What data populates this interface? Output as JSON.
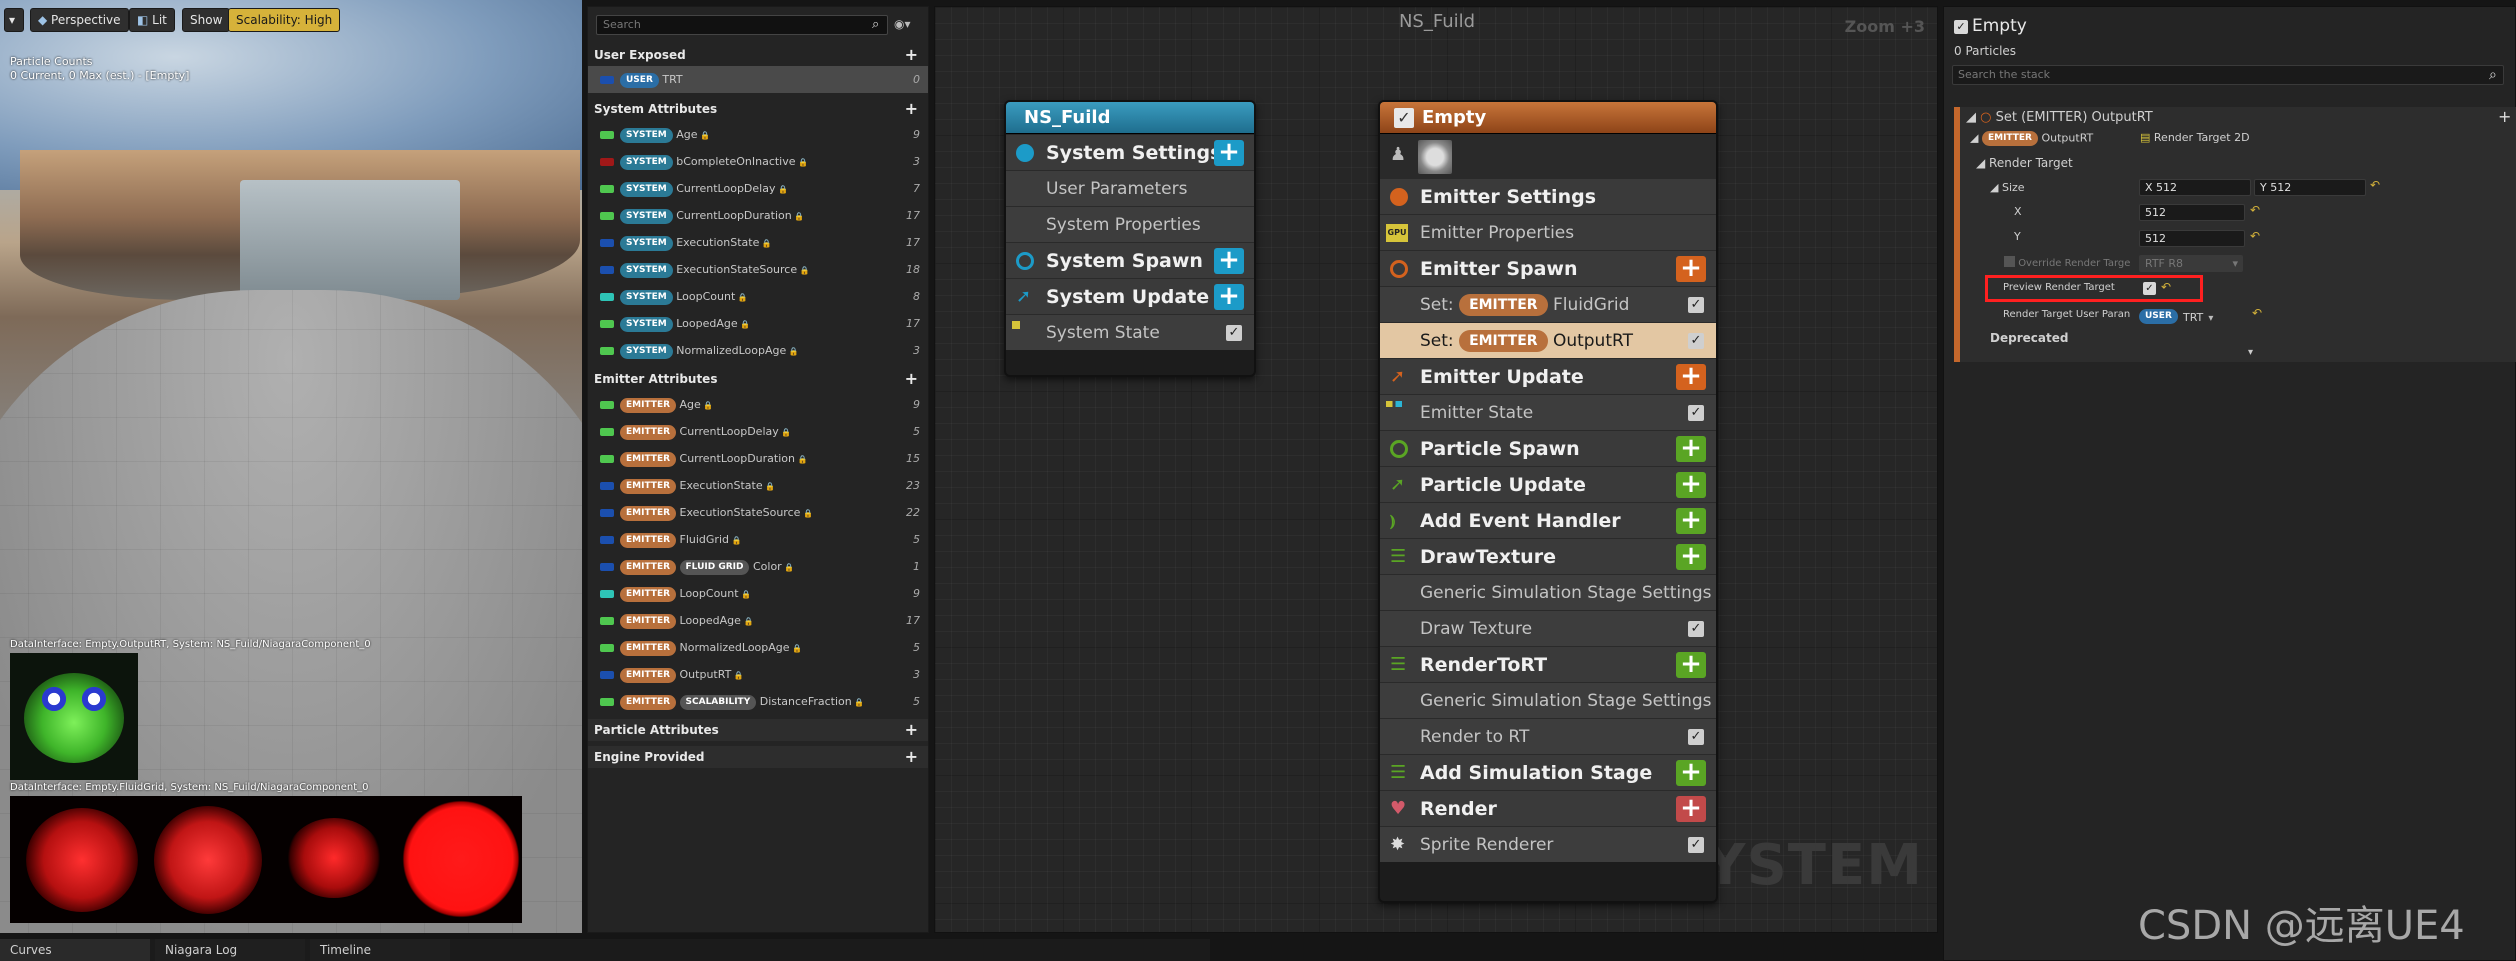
{
  "viewport": {
    "toolbar": {
      "menu": "▾",
      "perspective": "Perspective",
      "lit": "Lit",
      "show": "Show",
      "scalability": "Scalability: High"
    },
    "stats_line1": "Particle Counts",
    "stats_line2": "0 Current, 0 Max (est.) - [Empty]",
    "di_label_1": "DataInterface: Empty.OutputRT, System: NS_Fuild/NiagaraComponent_0",
    "di_label_2": "DataInterface: Empty.FluidGrid, System: NS_Fuild/NiagaraComponent_0"
  },
  "bottom_tabs": [
    "Curves",
    "Niagara Log",
    "Timeline"
  ],
  "params": {
    "search_placeholder": "Search",
    "user_exposed": {
      "title": "User Exposed",
      "items": [
        {
          "badge": "USER",
          "name": "TRT",
          "num": "0"
        }
      ]
    },
    "system_attributes": {
      "title": "System Attributes",
      "items": [
        {
          "badge": "SYSTEM",
          "name": "Age",
          "num": "9"
        },
        {
          "badge": "SYSTEM",
          "name": "bCompleteOnInactive",
          "num": "3"
        },
        {
          "badge": "SYSTEM",
          "name": "CurrentLoopDelay",
          "num": "7"
        },
        {
          "badge": "SYSTEM",
          "name": "CurrentLoopDuration",
          "num": "17"
        },
        {
          "badge": "SYSTEM",
          "name": "ExecutionState",
          "num": "17"
        },
        {
          "badge": "SYSTEM",
          "name": "ExecutionStateSource",
          "num": "18"
        },
        {
          "badge": "SYSTEM",
          "name": "LoopCount",
          "num": "8"
        },
        {
          "badge": "SYSTEM",
          "name": "LoopedAge",
          "num": "17"
        },
        {
          "badge": "SYSTEM",
          "name": "NormalizedLoopAge",
          "num": "3"
        }
      ]
    },
    "emitter_attributes": {
      "title": "Emitter Attributes",
      "items": [
        {
          "badge": "EMITTER",
          "name": "Age",
          "num": "9"
        },
        {
          "badge": "EMITTER",
          "name": "CurrentLoopDelay",
          "num": "5"
        },
        {
          "badge": "EMITTER",
          "name": "CurrentLoopDuration",
          "num": "15"
        },
        {
          "badge": "EMITTER",
          "name": "ExecutionState",
          "num": "23"
        },
        {
          "badge": "EMITTER",
          "name": "ExecutionStateSource",
          "num": "22"
        },
        {
          "badge": "EMITTER",
          "name": "FluidGrid",
          "num": "5"
        },
        {
          "badge": "EMITTER",
          "badge2": "FLUID GRID",
          "name": "Color",
          "num": "1"
        },
        {
          "badge": "EMITTER",
          "name": "LoopCount",
          "num": "9"
        },
        {
          "badge": "EMITTER",
          "name": "LoopedAge",
          "num": "17"
        },
        {
          "badge": "EMITTER",
          "name": "NormalizedLoopAge",
          "num": "5"
        },
        {
          "badge": "EMITTER",
          "name": "OutputRT",
          "num": "3"
        },
        {
          "badge": "EMITTER",
          "badge2": "SCALABILITY",
          "name": "DistanceFraction",
          "num": "5"
        }
      ]
    },
    "particle_attributes": "Particle Attributes",
    "engine_provided": "Engine Provided"
  },
  "graph": {
    "title": "NS_Fuild",
    "zoom": "Zoom +3",
    "watermark": "SYSTEM",
    "system_node": {
      "title": "NS_Fuild",
      "rows": {
        "settings": "System Settings",
        "user_params": "User Parameters",
        "properties": "System Properties",
        "spawn": "System Spawn",
        "update": "System Update",
        "state": "System State"
      }
    },
    "emitter_node": {
      "title": "Empty",
      "rows": {
        "settings": "Emitter Settings",
        "properties": "Emitter Properties",
        "gpu": "GPU",
        "spawn": "Emitter Spawn",
        "set_prefix": "Set:",
        "set_badge": "EMITTER",
        "set1": "FluidGrid",
        "set2": "OutputRT",
        "update": "Emitter Update",
        "state": "Emitter State",
        "pspawn": "Particle Spawn",
        "pupdate": "Particle Update",
        "event": "Add Event Handler",
        "draw": "DrawTexture",
        "gen1": "Generic Simulation Stage Settings",
        "drawtex": "Draw Texture",
        "rendertort": "RenderToRT",
        "gen2": "Generic Simulation Stage Settings",
        "rendertort_sub": "Render to RT",
        "addsim": "Add Simulation Stage",
        "render": "Render",
        "sprite": "Sprite Renderer"
      }
    }
  },
  "stack": {
    "title": "Empty",
    "particles": "0 Particles",
    "search_placeholder": "Search the stack",
    "module_title": "Set (EMITTER) OutputRT",
    "badge_emitter": "EMITTER",
    "var_name": "OutputRT",
    "var_type": "Render Target 2D",
    "render_target": "Render Target",
    "size": "Size",
    "size_x_label": "X",
    "size_x_val": "512",
    "size_y_label": "Y",
    "size_y_val": "512",
    "x": "X",
    "x_val": "512",
    "y": "Y",
    "y_val": "512",
    "override": "Override Render Targe",
    "override_val": "RTF R8",
    "preview": "Preview Render Target",
    "user_param": "Render Target User Paran",
    "user_badge": "USER",
    "user_val": "TRT",
    "deprecated": "Deprecated"
  },
  "watermark": "CSDN @远离UE4",
  "colors": {
    "emitter_header": "#b5612a",
    "system_header": "#2e7fa0",
    "add_green": "#5aa524",
    "add_orange": "#d4621e",
    "add_cyan": "#1c9bc8",
    "add_red": "#c24a4a",
    "highlight": "#ff2020"
  }
}
